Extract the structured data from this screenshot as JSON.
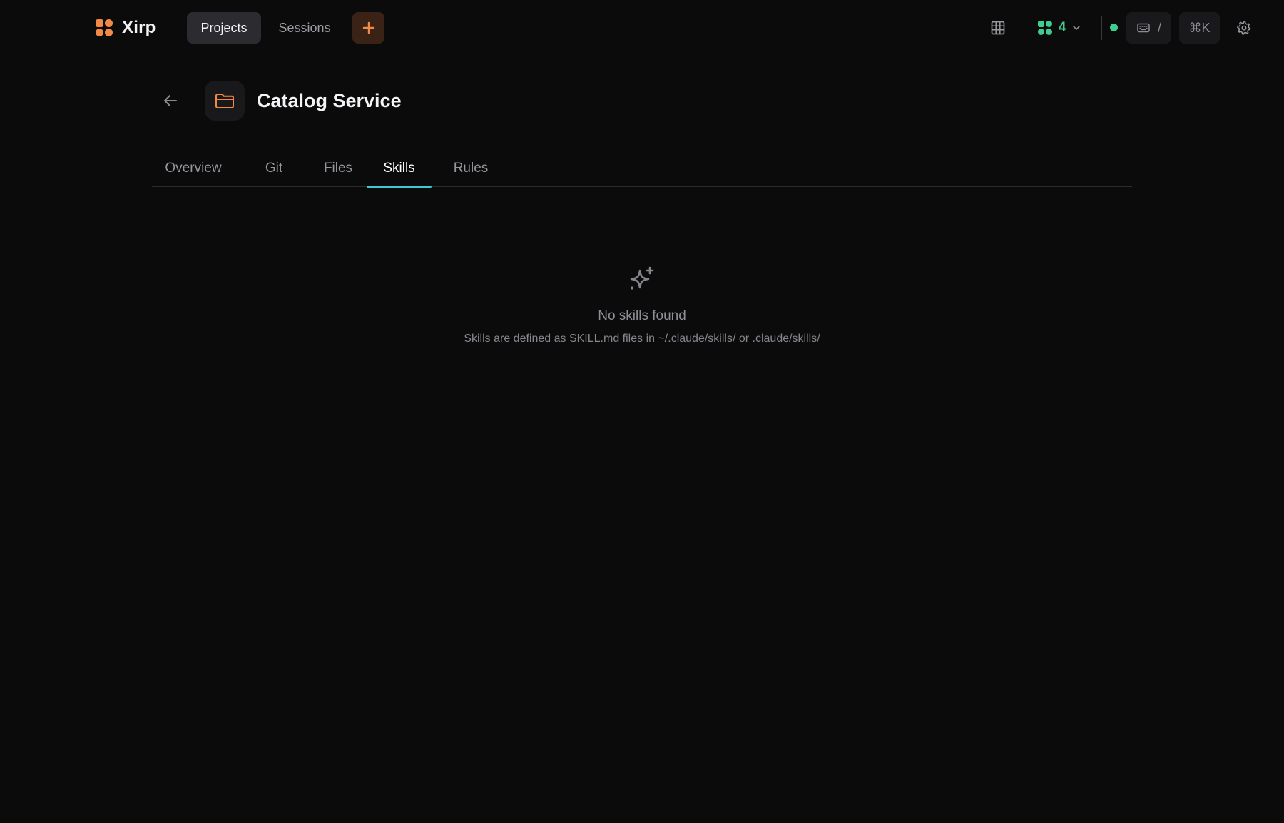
{
  "app": {
    "name": "Xirp"
  },
  "nav": {
    "projects_label": "Projects",
    "sessions_label": "Sessions",
    "add_icon": "plus-icon"
  },
  "toolbar": {
    "agents_count": "4",
    "shortcut_slash": "/",
    "command_palette": "⌘K",
    "status_color": "#3ecf8e"
  },
  "header": {
    "title": "Catalog Service",
    "icon": "folder-icon",
    "accent": "#f08a45"
  },
  "tabs": [
    {
      "label": "Overview",
      "active": false
    },
    {
      "label": "Git",
      "active": false
    },
    {
      "label": "Files",
      "active": false
    },
    {
      "label": "Skills",
      "active": true
    },
    {
      "label": "Rules",
      "active": false
    }
  ],
  "empty_state": {
    "icon": "sparkles-icon",
    "title": "No skills found",
    "subtitle": "Skills are defined as SKILL.md files in ~/.claude/skills/ or .claude/skills/"
  },
  "colors": {
    "background": "#0b0b0c",
    "brand": "#f08a45",
    "active_tab_underline": "#3fc9d6",
    "agents": "#3ecf8e"
  }
}
